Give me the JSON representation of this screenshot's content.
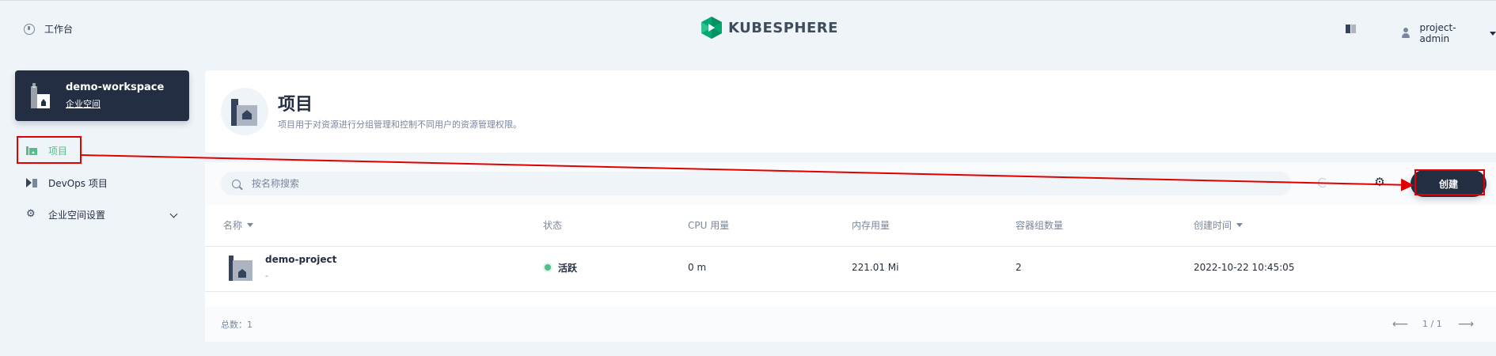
{
  "header": {
    "workbench_label": "工作台",
    "brand_name": "KUBESPHERE",
    "user_name": "project-admin"
  },
  "sidebar": {
    "workspace_name": "demo-workspace",
    "workspace_type": "企业空间",
    "items": [
      {
        "label": "项目",
        "icon": "project-icon",
        "active": true
      },
      {
        "label": "DevOps 项目",
        "icon": "devops-icon",
        "active": false
      },
      {
        "label": "企业空间设置",
        "icon": "gear-icon",
        "active": false
      }
    ]
  },
  "banner": {
    "title": "项目",
    "description": "项目用于对资源进行分组管理和控制不同用户的资源管理权限。"
  },
  "toolbar": {
    "search_placeholder": "按名称搜索",
    "create_label": "创建"
  },
  "table": {
    "columns": [
      "名称",
      "状态",
      "CPU 用量",
      "内存用量",
      "容器组数量",
      "创建时间"
    ],
    "rows": [
      {
        "name": "demo-project",
        "description": "-",
        "status": "活跃",
        "cpu": "0 m",
        "memory": "221.01 Mi",
        "pods": "2",
        "created": "2022-10-22 10:45:05"
      }
    ]
  },
  "footer": {
    "total": "总数：1",
    "page": "1 / 1"
  },
  "colors": {
    "accent": "#55bc8a",
    "dark": "#242e42",
    "annotation": "#e00000"
  }
}
